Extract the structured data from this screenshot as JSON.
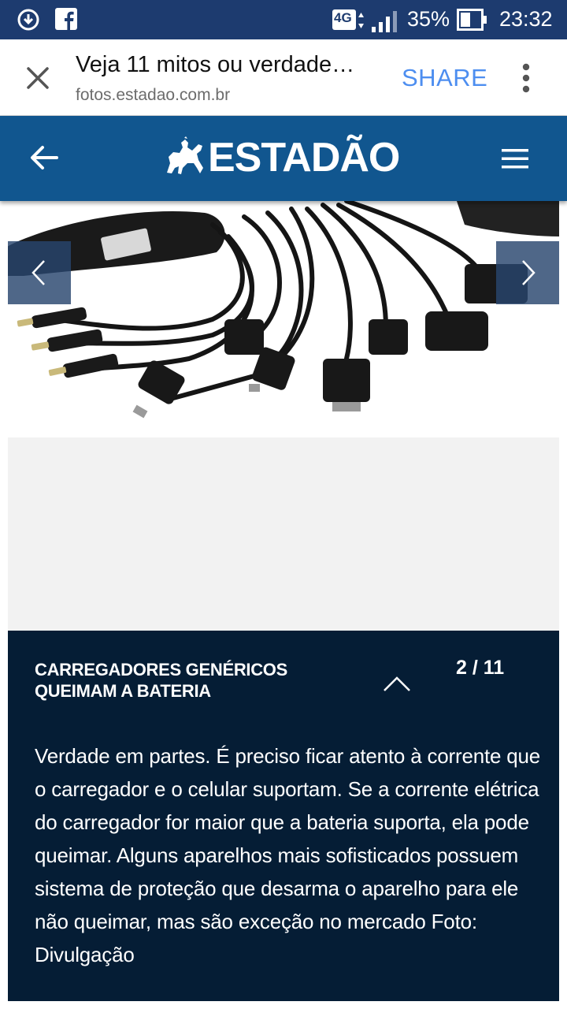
{
  "status_bar": {
    "network": "4G",
    "battery": "35%",
    "time": "23:32",
    "icons": [
      "download-icon",
      "facebook-icon",
      "signal-icon",
      "battery-icon"
    ]
  },
  "browser_tab": {
    "title": "Veja 11 mitos ou verdade…",
    "url": "fotos.estadao.com.br",
    "share_label": "SHARE",
    "icons": [
      "close-icon",
      "more-vert-icon"
    ]
  },
  "site_header": {
    "logo": "ESTADÃO",
    "icons": [
      "back-arrow-icon",
      "horse-rider-logo-icon",
      "hamburger-menu-icon"
    ]
  },
  "gallery": {
    "counter": "2 / 11",
    "caption_title": "CARREGADORES GENÉRICOS QUEIMAM A BATERIA",
    "caption_text": "Verdade em partes. É preciso ficar atento à corrente que o carregador e o celular suportam. Se a corrente elétrica do carregador for maior que a bateria suporta, ela pode queimar. Alguns aparelhos mais sofisticados possuem sistema de proteção que desarma o aparelho para ele não queimar, mas são exceção no mercado Foto: Divulgação",
    "icons": [
      "chevron-left-icon",
      "chevron-right-icon",
      "chevron-up-icon"
    ]
  },
  "colors": {
    "status_bar": "#1d3b6f",
    "header": "#11568f",
    "caption_bg": "#051d35",
    "share": "#4d8ef0"
  }
}
